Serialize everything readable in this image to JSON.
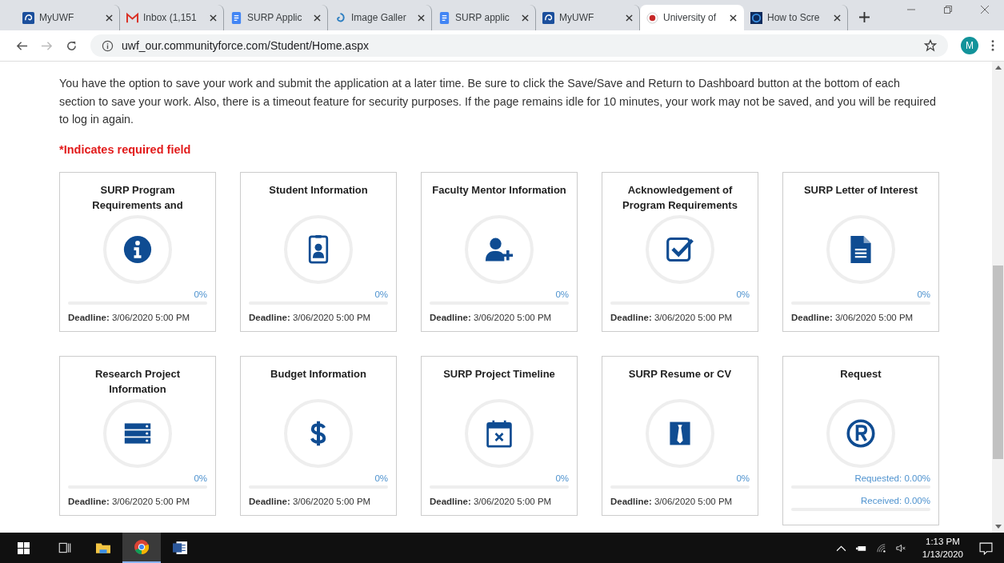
{
  "browser": {
    "tabs": [
      {
        "title": "MyUWF",
        "selected": false
      },
      {
        "title": "Inbox (1,151",
        "selected": false
      },
      {
        "title": "SURP Applic",
        "selected": false
      },
      {
        "title": "Image Galler",
        "selected": false
      },
      {
        "title": "SURP applic",
        "selected": false
      },
      {
        "title": "MyUWF",
        "selected": false
      },
      {
        "title": "University of",
        "selected": true
      },
      {
        "title": "How to Scre",
        "selected": false
      }
    ],
    "url": "uwf_our.communityforce.com/Student/Home.aspx",
    "avatar": "M"
  },
  "intro": "You have the option to save your work and submit the application at a later time. Be sure to click the Save/Save and Return to Dashboard button at the bottom of each section to save your work. Also, there is a timeout feature for security purposes. If the page remains idle for 10 minutes, your work may not be saved, and you will be required to log in again.",
  "required_note": "*Indicates required field",
  "cards": [
    {
      "kind": "section",
      "title": "SURP Program Requirements and",
      "percent": "0%",
      "level": 0,
      "deadline_label": "Deadline:",
      "deadline": "3/06/2020 5:00 PM"
    },
    {
      "kind": "section",
      "title": "Student Information",
      "percent": "0%",
      "level": 0,
      "deadline_label": "Deadline:",
      "deadline": "3/06/2020 5:00 PM"
    },
    {
      "kind": "section",
      "title": "Faculty Mentor Information",
      "percent": "0%",
      "level": 0,
      "deadline_label": "Deadline:",
      "deadline": "3/06/2020 5:00 PM"
    },
    {
      "kind": "section",
      "title": "Acknowledgement of Program Requirements",
      "percent": "0%",
      "level": 0,
      "deadline_label": "Deadline:",
      "deadline": "3/06/2020 5:00 PM"
    },
    {
      "kind": "section",
      "title": "SURP Letter of Interest",
      "percent": "0%",
      "level": 0,
      "deadline_label": "Deadline:",
      "deadline": "3/06/2020 5:00 PM"
    },
    {
      "kind": "section",
      "title": "Research Project Information",
      "percent": "0%",
      "level": 0,
      "deadline_label": "Deadline:",
      "deadline": "3/06/2020 5:00 PM"
    },
    {
      "kind": "section",
      "title": "Budget Information",
      "percent": "0%",
      "level": 0,
      "deadline_label": "Deadline:",
      "deadline": "3/06/2020 5:00 PM"
    },
    {
      "kind": "section",
      "title": "SURP Project Timeline",
      "percent": "0%",
      "level": 0,
      "deadline_label": "Deadline:",
      "deadline": "3/06/2020 5:00 PM"
    },
    {
      "kind": "section",
      "title": "SURP Resume or CV",
      "percent": "0%",
      "level": 0,
      "deadline_label": "Deadline:",
      "deadline": "3/06/2020 5:00 PM"
    },
    {
      "kind": "request",
      "title": "Request",
      "bars": [
        {
          "label": "Requested: 0.00%",
          "level": 0
        },
        {
          "label": "Received: 0.00%",
          "level": 0
        }
      ]
    }
  ],
  "taskbar": {
    "apps": [
      {
        "selected": false
      },
      {
        "selected": false
      },
      {
        "selected": true
      },
      {
        "selected": false
      }
    ],
    "time": "1:13 PM",
    "date": "1/13/2020"
  }
}
